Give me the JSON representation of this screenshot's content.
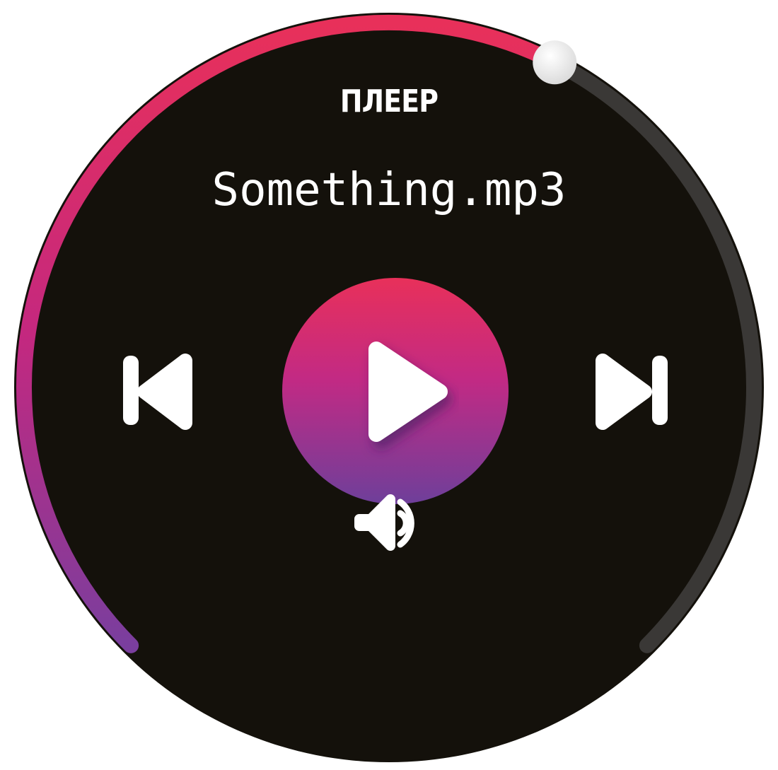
{
  "app": {
    "title": "ПЛЕЕР"
  },
  "track": {
    "name": "Something.mp3"
  },
  "controls": {
    "previous_icon": "skip-previous-icon",
    "play_icon": "play-icon",
    "next_icon": "skip-next-icon",
    "volume_icon": "volume-icon"
  },
  "progress": {
    "fraction": 0.6
  },
  "colors": {
    "background": "#14110b",
    "accent_start": "#e8305a",
    "accent_mid": "#c4287f",
    "accent_end": "#6e3f9a",
    "track_remaining": "#3a3836",
    "foreground": "#ffffff"
  }
}
